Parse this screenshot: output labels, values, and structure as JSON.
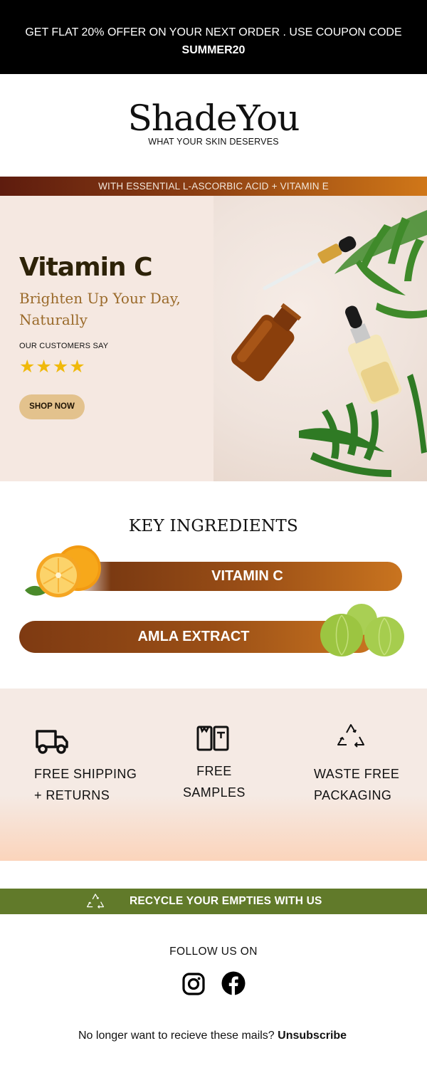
{
  "promo_bar": {
    "line1": "GET FLAT 20% OFFER ON YOUR NEXT ORDER . USE COUPON CODE",
    "code": "SUMMER20"
  },
  "brand": {
    "logo": "ShadeYou",
    "tagline": "WHAT YOUR SKIN DESERVES"
  },
  "stripe": {
    "text": "WITH ESSENTIAL L-ASCORBIC ACID + VITAMIN E"
  },
  "hero": {
    "title": "Vitamin C",
    "subtitle": "Brighten Up Your Day, Naturally",
    "customers_label": "OUR CUSTOMERS SAY",
    "stars": "★★★★",
    "rating": 4,
    "cta": "SHOP NOW"
  },
  "ingredients": {
    "title": "KEY INGREDIENTS",
    "items": [
      {
        "label": "VITAMIN C",
        "icon": "orange-fruit-icon"
      },
      {
        "label": "AMLA EXTRACT",
        "icon": "amla-fruit-icon"
      }
    ]
  },
  "features": [
    {
      "line1": "FREE SHIPPING",
      "line2": "+ RETURNS",
      "icon": "truck-icon"
    },
    {
      "line1": "FREE",
      "line2": "SAMPLES",
      "icon": "sample-bottles-icon"
    },
    {
      "line1": "WASTE FREE",
      "line2": "PACKAGING",
      "icon": "recycle-icon"
    }
  ],
  "recycle_banner": {
    "text": "RECYCLE YOUR EMPTIES WITH US",
    "icon": "recycle-icon"
  },
  "social": {
    "label": "FOLLOW US ON",
    "icons": [
      "instagram-icon",
      "facebook-icon"
    ]
  },
  "footer": {
    "unsubscribe_prompt": "No longer want to recieve these mails?",
    "unsubscribe_link": "Unsubscribe"
  },
  "colors": {
    "accent_brown": "#9b4f16",
    "accent_orange": "#c9741f",
    "star_gold": "#f0b90b",
    "cta_tan": "#e3c28d",
    "green_banner": "#617a2a",
    "hero_bg": "#f5e8e1"
  }
}
